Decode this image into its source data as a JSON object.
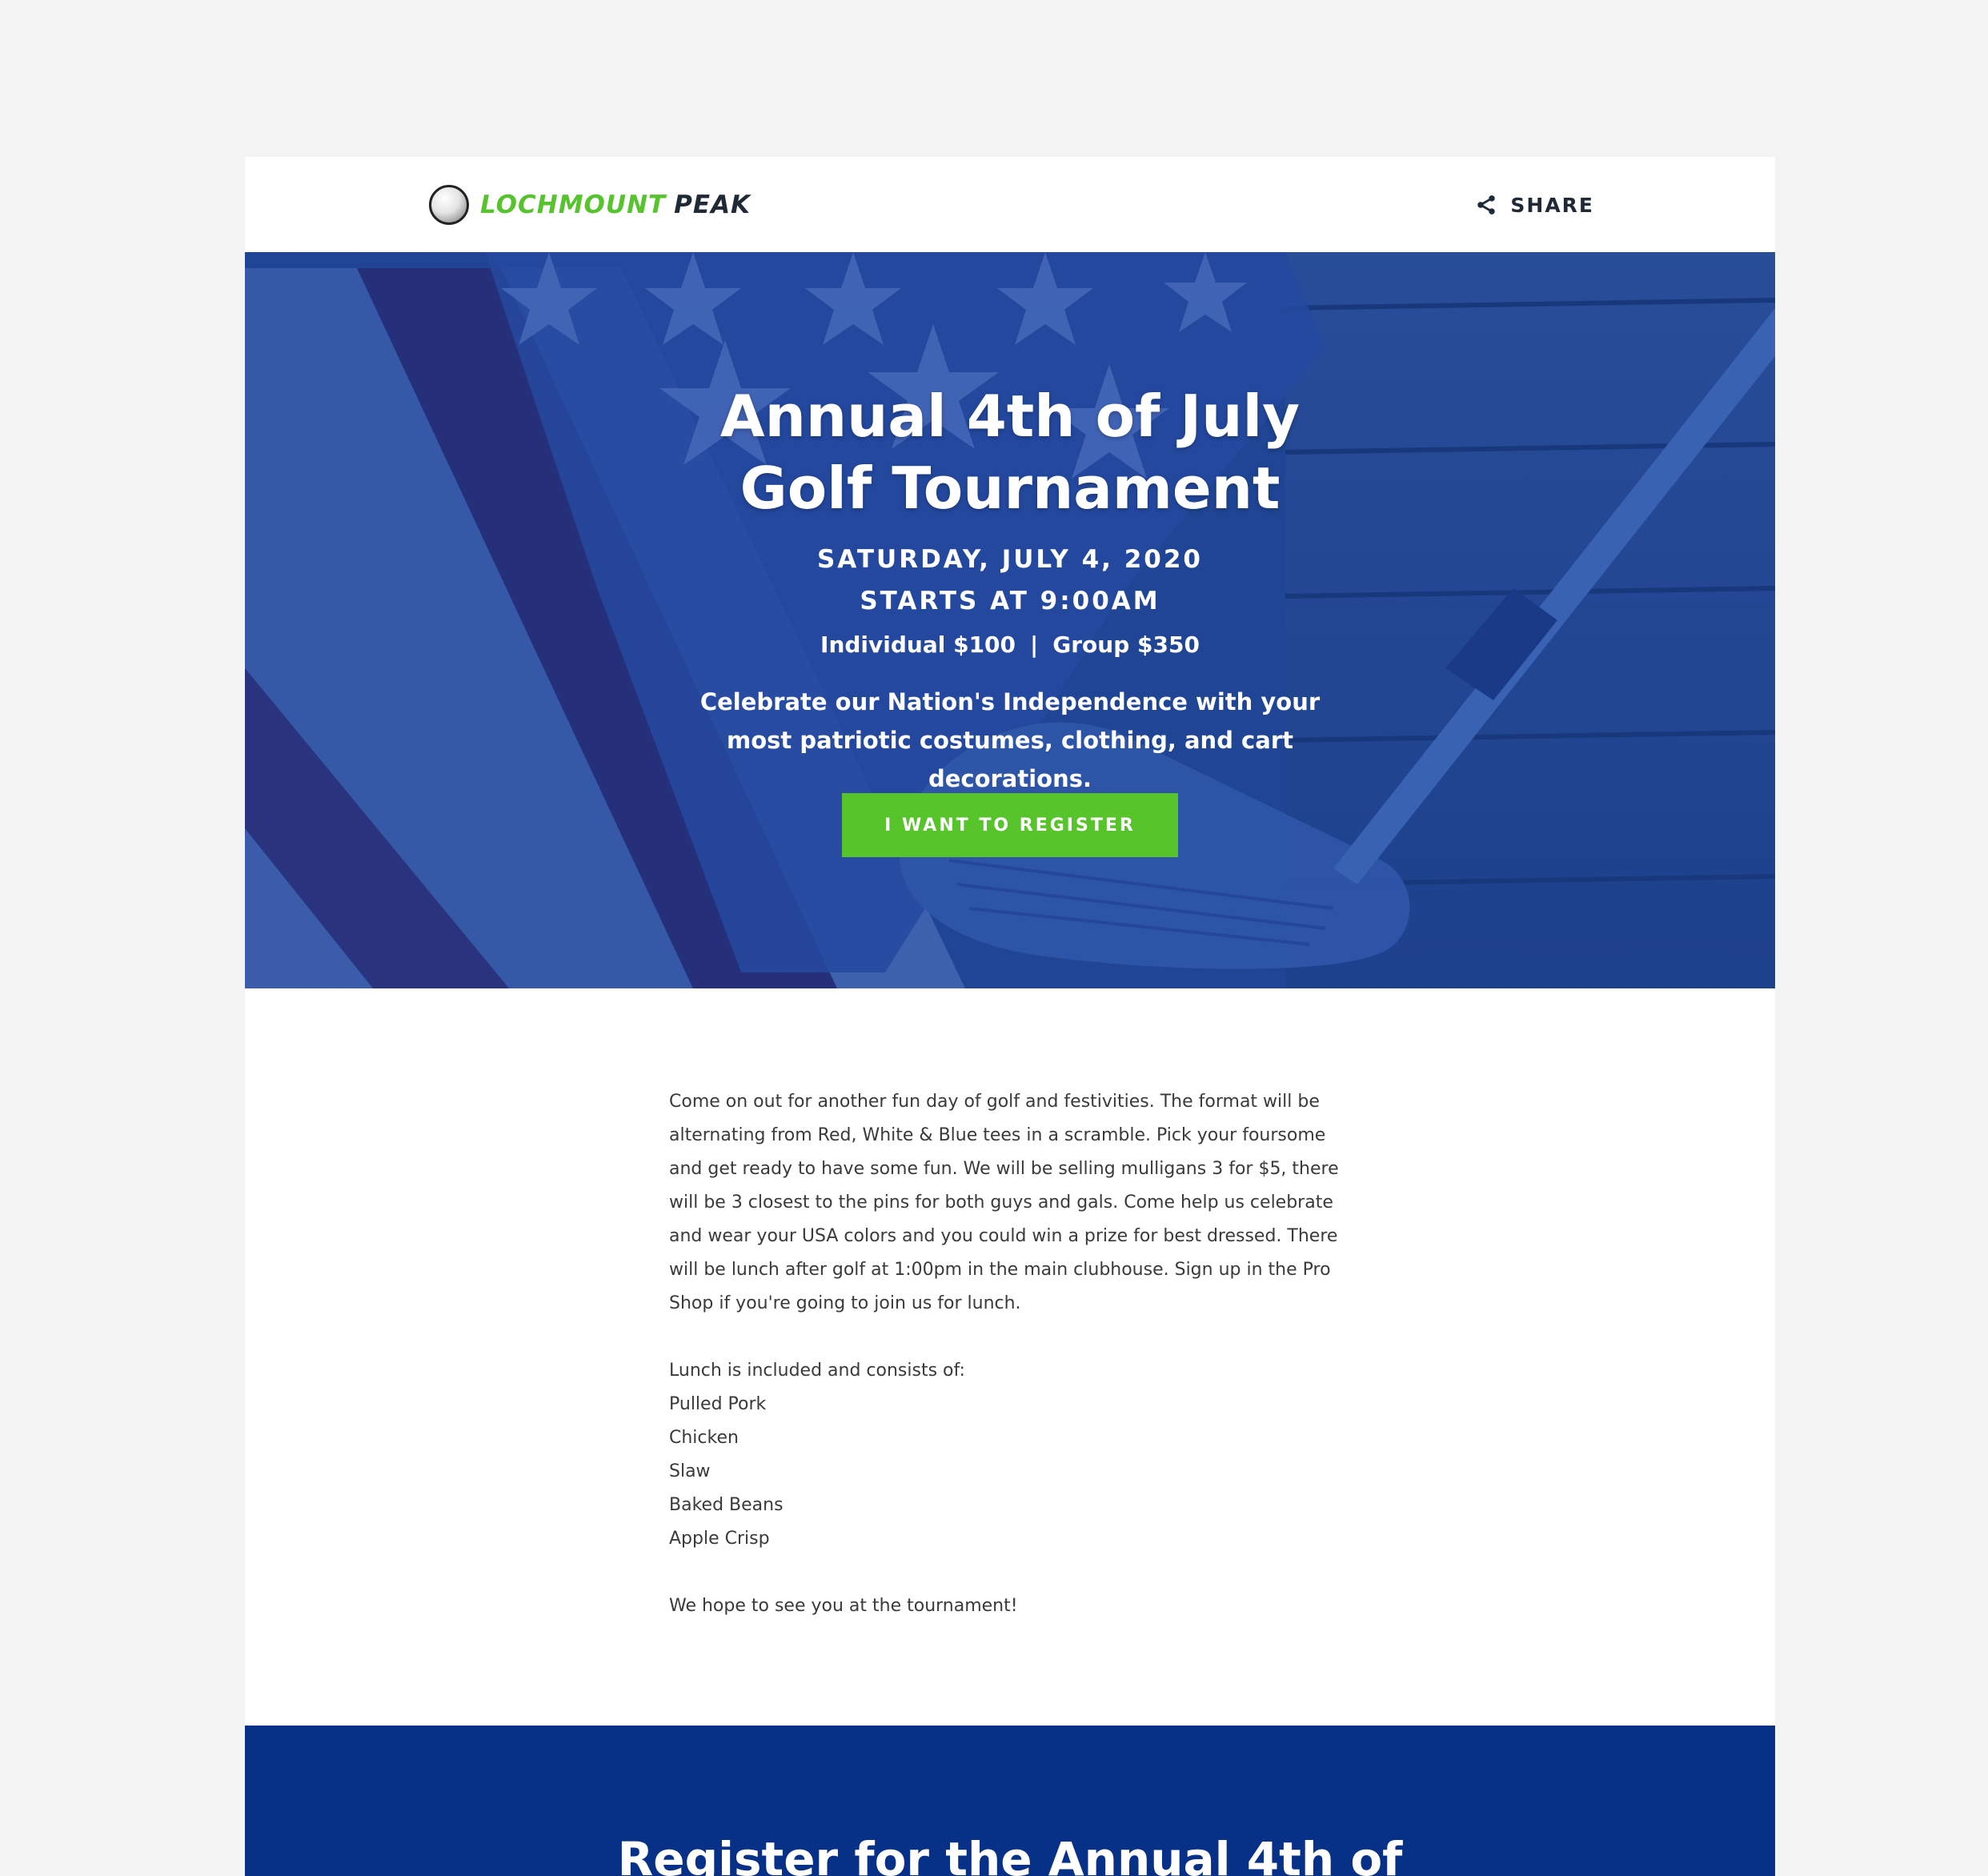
{
  "brand": {
    "name_part1": "LOCHMOUNT",
    "name_part2": "PEAK",
    "accent_color": "#56c32f",
    "dark_color": "#1f2a36"
  },
  "header": {
    "share_label": "SHARE"
  },
  "hero": {
    "title_line1": "Annual 4th of July",
    "title_line2": "Golf Tournament",
    "date": "SATURDAY, JULY 4, 2020",
    "time": "STARTS AT 9:00AM",
    "price_individual": "Individual $100",
    "price_separator": "|",
    "price_group": "Group $350",
    "description": "Celebrate our Nation's Independence with your most patriotic costumes, clothing, and cart decorations.",
    "cta_label": "I WANT TO REGISTER",
    "overlay_color": "#1f4594",
    "button_color": "#57c42b"
  },
  "content": {
    "intro": "Come on out for another fun day of golf and festivities. The format will be alternating from Red, White & Blue tees in a scramble. Pick your foursome and get ready to have some fun. We will be selling mulligans 3 for $5, there will be 3 closest to the pins for both guys and gals. Come help us celebrate and wear your USA colors and you could win a prize for best dressed. There will be lunch after golf at 1:00pm in the main clubhouse. Sign up in the Pro Shop if you're going to join us for lunch.",
    "lunch_heading": "Lunch is included and consists of:",
    "lunch_items": [
      "Pulled Pork",
      "Chicken",
      "Slaw",
      "Baked Beans",
      "Apple Crisp"
    ],
    "closing": "We hope to see you at the tournament!"
  },
  "register": {
    "title": "Register for the Annual 4th of",
    "band_color": "#073187"
  },
  "icons": {
    "logo": "golf-ball-icon",
    "share": "share-icon"
  }
}
